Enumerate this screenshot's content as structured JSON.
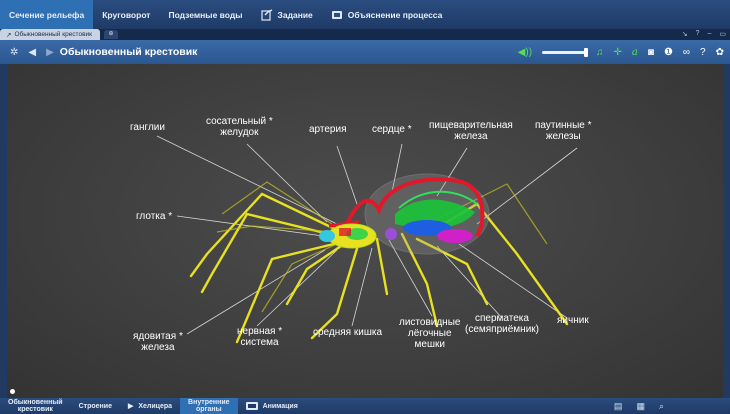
{
  "top_tabs": [
    {
      "label": "Сечение рельефа",
      "icon": ""
    },
    {
      "label": "Круговорот",
      "icon": ""
    },
    {
      "label": "Подземные воды",
      "icon": ""
    },
    {
      "label": "Задание",
      "icon": "task-icon"
    },
    {
      "label": "Объяснение процесса",
      "icon": "video-icon"
    }
  ],
  "doc_tab": {
    "label": "Обыкновенный крестовик"
  },
  "toolbar": {
    "title": "Обыкновенный крестовик"
  },
  "labels": {
    "ganglia": "ганглии",
    "sucking_stomach_1": "сосательный",
    "sucking_stomach_2": "желудок",
    "artery": "артерия",
    "heart": "сердце",
    "digestive_gland_1": "пищеварительная",
    "digestive_gland_2": "железа",
    "silk_glands_1": "паутинные",
    "silk_glands_2": "железы",
    "pharynx": "глотка",
    "venom_gland_1": "ядовитая",
    "venom_gland_2": "железа",
    "nervous_system_1": "нервная",
    "nervous_system_2": "система",
    "midgut": "средняя кишка",
    "book_lungs_1": "листовидные",
    "book_lungs_2": "лёгочные",
    "book_lungs_3": "мешки",
    "spermatheca_1": "сперматека",
    "spermatheca_2": "(семяприёмник)",
    "ovary": "яичник",
    "asterisk": "*"
  },
  "bottom_tabs": [
    {
      "label_1": "Обыкновенный",
      "label_2": "крестовик"
    },
    {
      "label": "Строение"
    },
    {
      "label": "Хелицера",
      "icon": "play-icon"
    },
    {
      "label_1": "Внутренние",
      "label_2": "органы"
    },
    {
      "label": "Анимация",
      "icon": "video-icon"
    }
  ],
  "colors": {
    "accent": "#2f6fb4",
    "organ_red": "#e0182a",
    "organ_green": "#19c43a",
    "organ_blue": "#1d5fe0",
    "organ_magenta": "#d020c8",
    "leg_yellow": "#e8e021"
  }
}
